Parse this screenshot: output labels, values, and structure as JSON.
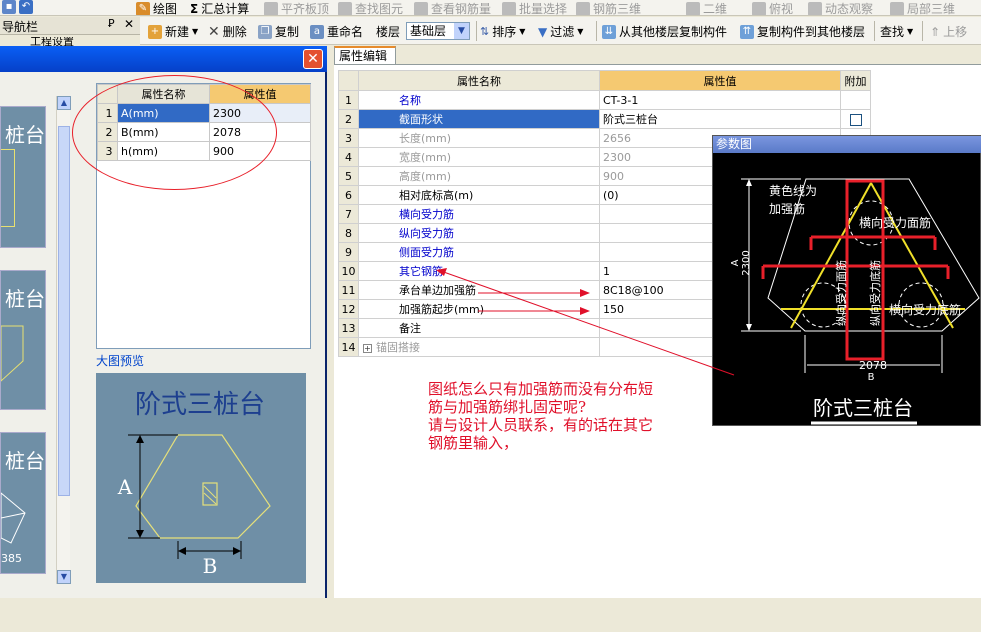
{
  "toolbar_top": {
    "items": [
      {
        "label": "绘图",
        "icon": "draw-icon",
        "enabled": true
      },
      {
        "label": "汇总计算",
        "icon": "sum-icon",
        "enabled": true
      },
      {
        "label": "平齐板顶",
        "icon": "align-icon",
        "enabled": false
      },
      {
        "label": "查找图元",
        "icon": "find-icon",
        "enabled": false
      },
      {
        "label": "查看钢筋量",
        "icon": "view-rebar-icon",
        "enabled": false
      },
      {
        "label": "批量选择",
        "icon": "batch-select-icon",
        "enabled": false
      },
      {
        "label": "钢筋三维",
        "icon": "rebar-3d-icon",
        "enabled": false
      },
      {
        "label": "二维",
        "icon": "2d-icon",
        "enabled": false
      },
      {
        "label": "俯视",
        "icon": "top-view-icon",
        "enabled": false
      },
      {
        "label": "动态观察",
        "icon": "orbit-icon",
        "enabled": false
      },
      {
        "label": "局部三维",
        "icon": "local-3d-icon",
        "enabled": false
      }
    ]
  },
  "toolbar_main": {
    "new_label": "新建",
    "delete_label": "删除",
    "copy_label": "复制",
    "rename_label": "重命名",
    "floor_label": "楼层",
    "floor_value": "基础层",
    "sort_label": "排序",
    "filter_label": "过滤",
    "copy_from_label": "从其他楼层复制构件",
    "copy_to_label": "复制构件到其他楼层",
    "find_label": "查找",
    "move_up_label": "上移"
  },
  "nav_panel": {
    "title": "导航栏",
    "sub_label": "工程设置"
  },
  "dialog": {
    "param_table": {
      "headers": [
        "属性名称",
        "属性值"
      ],
      "rows": [
        {
          "num": "1",
          "name": "A(mm)",
          "value": "2300"
        },
        {
          "num": "2",
          "name": "B(mm)",
          "value": "2078"
        },
        {
          "num": "3",
          "name": "h(mm)",
          "value": "900"
        }
      ]
    },
    "preview_label": "大图预览",
    "preview_title": "阶式三桩台",
    "preview_a": "A",
    "preview_b": "B",
    "thumb_labels": [
      "桩台",
      "桩台",
      "桩台"
    ],
    "thumb_number": "385"
  },
  "property_editor": {
    "tab_label": "属性编辑",
    "headers": [
      "属性名称",
      "属性值",
      "附加"
    ],
    "rows": [
      {
        "num": "1",
        "name": "名称",
        "value": "CT-3-1",
        "style": "blue",
        "checkbox": false
      },
      {
        "num": "2",
        "name": "截面形状",
        "value": "阶式三桩台",
        "style": "selected",
        "checkbox": true
      },
      {
        "num": "3",
        "name": "长度(mm)",
        "value": "2656",
        "style": "gray",
        "checkbox": false
      },
      {
        "num": "4",
        "name": "宽度(mm)",
        "value": "2300",
        "style": "gray",
        "checkbox": false
      },
      {
        "num": "5",
        "name": "高度(mm)",
        "value": "900",
        "style": "gray",
        "checkbox": false
      },
      {
        "num": "6",
        "name": "相对底标高(m)",
        "value": "(0)",
        "style": "normal",
        "checkbox": false
      },
      {
        "num": "7",
        "name": "横向受力筋",
        "value": "",
        "style": "blue",
        "checkbox": false
      },
      {
        "num": "8",
        "name": "纵向受力筋",
        "value": "",
        "style": "blue",
        "checkbox": false
      },
      {
        "num": "9",
        "name": "侧面受力筋",
        "value": "",
        "style": "blue",
        "checkbox": false
      },
      {
        "num": "10",
        "name": "其它钢筋",
        "value": "1",
        "style": "blue",
        "checkbox": false
      },
      {
        "num": "11",
        "name": "承台单边加强筋",
        "value": "8C18@100",
        "style": "normal",
        "checkbox": false
      },
      {
        "num": "12",
        "name": "加强筋起步(mm)",
        "value": "150",
        "style": "normal",
        "checkbox": false
      },
      {
        "num": "13",
        "name": "备注",
        "value": "",
        "style": "normal",
        "checkbox": false
      },
      {
        "num": "14",
        "name": "锚固搭接",
        "value": "",
        "style": "group",
        "checkbox": false
      }
    ]
  },
  "param_diagram": {
    "title": "参数图",
    "yellow_label_1": "黄色线为",
    "yellow_label_2": "加强筋",
    "transverse_face": "横向受力面筋",
    "transverse_bottom": "横向受力底筋",
    "longitudinal_face": "纵向受力面筋",
    "longitudinal_bottom": "纵向受力底筋",
    "dim_a": "A",
    "dim_a_value": "2300",
    "dim_b": "B",
    "dim_b_value": "2078",
    "caption": "阶式三桩台"
  },
  "annotation": {
    "line1": "图纸怎么只有加强筋而没有分布短",
    "line2": "筋与加强筋绑扎固定呢?",
    "line3": "请与设计人员联系，有的话在其它",
    "line4": "钢筋里输入，"
  },
  "colors": {
    "selection": "#316ac5",
    "header_value": "#f5c971",
    "annotation_red": "#e0102a",
    "preview_bg": "#6f8fa6"
  }
}
